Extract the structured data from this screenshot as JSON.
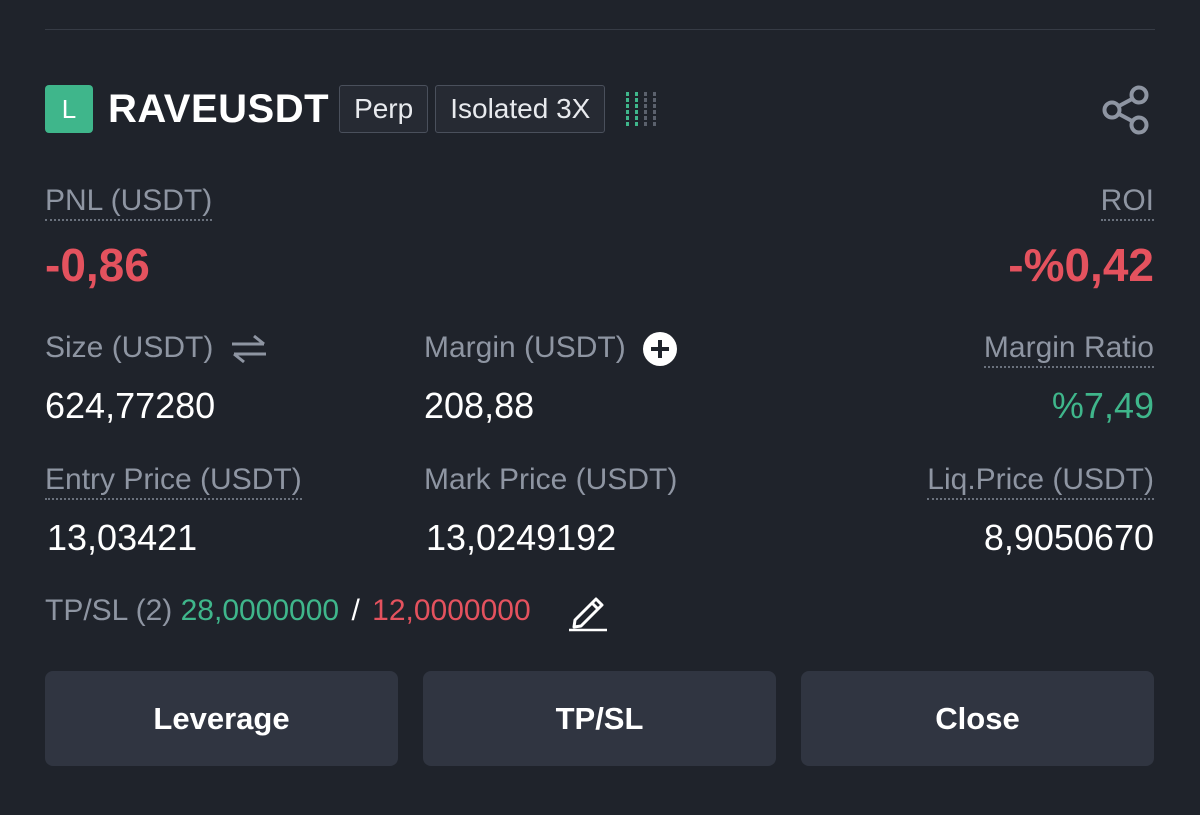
{
  "position": {
    "side_letter": "L",
    "symbol": "RAVEUSDT",
    "contract_type": "Perp",
    "margin_mode": "Isolated 3X",
    "signal_icon": "signal-strength-icon",
    "share_icon": "share-icon"
  },
  "pnl": {
    "label": "PNL (USDT)",
    "value": "-0,86"
  },
  "roi": {
    "label": "ROI",
    "value": "-%0,42"
  },
  "size": {
    "label": "Size (USDT)",
    "value": "624,77280",
    "icon": "swap-arrows-icon"
  },
  "margin": {
    "label": "Margin (USDT)",
    "value": "208,88",
    "icon": "plus-circle-icon"
  },
  "margin_ratio": {
    "label": "Margin Ratio",
    "value": "%7,49"
  },
  "entry_price": {
    "label": "Entry Price (USDT)",
    "value": "13,03421"
  },
  "mark_price": {
    "label": "Mark Price (USDT)",
    "value": "13,0249192"
  },
  "liq_price": {
    "label": "Liq.Price (USDT)",
    "value": "8,9050670"
  },
  "tpsl": {
    "label": "TP/SL (2)",
    "take_profit": "28,0000000",
    "separator": "/",
    "stop_loss": "12,0000000",
    "edit_icon": "pencil-icon"
  },
  "buttons": {
    "leverage": "Leverage",
    "tpsl": "TP/SL",
    "close": "Close"
  },
  "colors": {
    "background": "#1f232b",
    "positive": "#3fb68b",
    "negative": "#e4525e",
    "muted_text": "#8e95a2",
    "button_bg": "#303541"
  }
}
